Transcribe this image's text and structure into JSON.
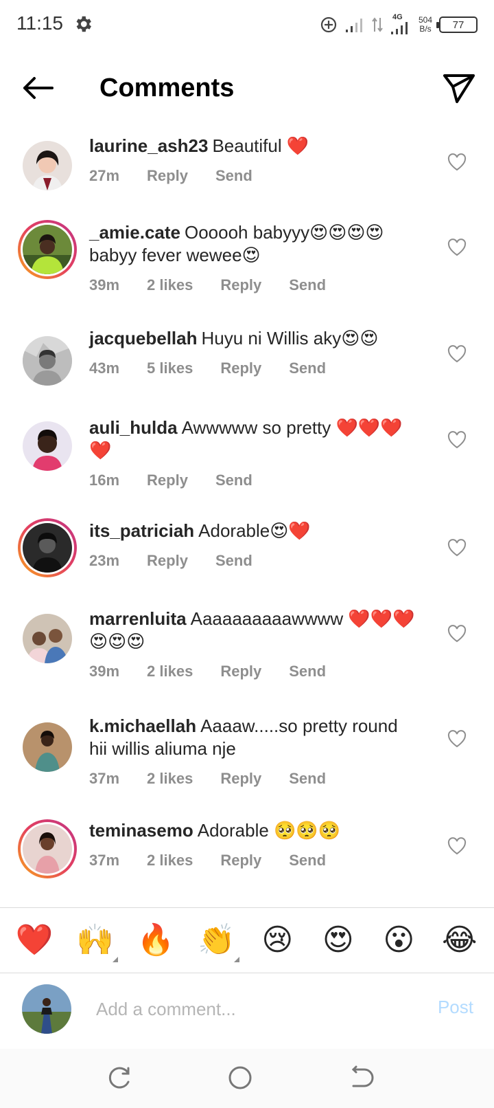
{
  "status_bar": {
    "time": "11:15",
    "network": "4G",
    "speed_value": "504",
    "speed_unit": "B/s",
    "battery": "77"
  },
  "header": {
    "title": "Comments"
  },
  "comments": [
    {
      "username": "laurine_ash23",
      "text": "Beautiful ❤️",
      "time": "27m",
      "likes": "",
      "reply": "Reply",
      "send": "Send"
    },
    {
      "username": "_amie.cate",
      "text": "Oooooh babyyy😍😍😍😍 babyy fever wewee😍",
      "time": "39m",
      "likes": "2 likes",
      "reply": "Reply",
      "send": "Send"
    },
    {
      "username": "jacquebellah",
      "text": "Huyu ni Willis aky😍😍",
      "time": "43m",
      "likes": "5 likes",
      "reply": "Reply",
      "send": "Send"
    },
    {
      "username": "auli_hulda",
      "text": "Awwwww so pretty ❤️❤️❤️❤️",
      "time": "16m",
      "likes": "",
      "reply": "Reply",
      "send": "Send"
    },
    {
      "username": "its_patriciah",
      "text": "Adorable😍❤️",
      "time": "23m",
      "likes": "",
      "reply": "Reply",
      "send": "Send"
    },
    {
      "username": "marrenluita",
      "text": "Aaaaaaaaaawwww ❤️❤️❤️😍😍😍",
      "time": "39m",
      "likes": "2 likes",
      "reply": "Reply",
      "send": "Send"
    },
    {
      "username": "k.michaellah",
      "text": "Aaaaw.....so pretty round hii willis aliuma nje",
      "time": "37m",
      "likes": "2 likes",
      "reply": "Reply",
      "send": "Send"
    },
    {
      "username": "teminasemo",
      "text": "Adorable 🥺🥺🥺",
      "time": "37m",
      "likes": "2 likes",
      "reply": "Reply",
      "send": "Send"
    }
  ],
  "emoji_bar": [
    "❤️",
    "🙌",
    "🔥",
    "👏",
    "😢",
    "😍",
    "😮",
    "😂"
  ],
  "composer": {
    "placeholder": "Add a comment...",
    "post_label": "Post"
  },
  "colors": {
    "meta_text": "#8e8e8e",
    "post_disabled": "#b3dbff",
    "story_ring_start": "#f9a71b",
    "story_ring_end": "#c13584",
    "heart_red": "#ed1c24"
  }
}
